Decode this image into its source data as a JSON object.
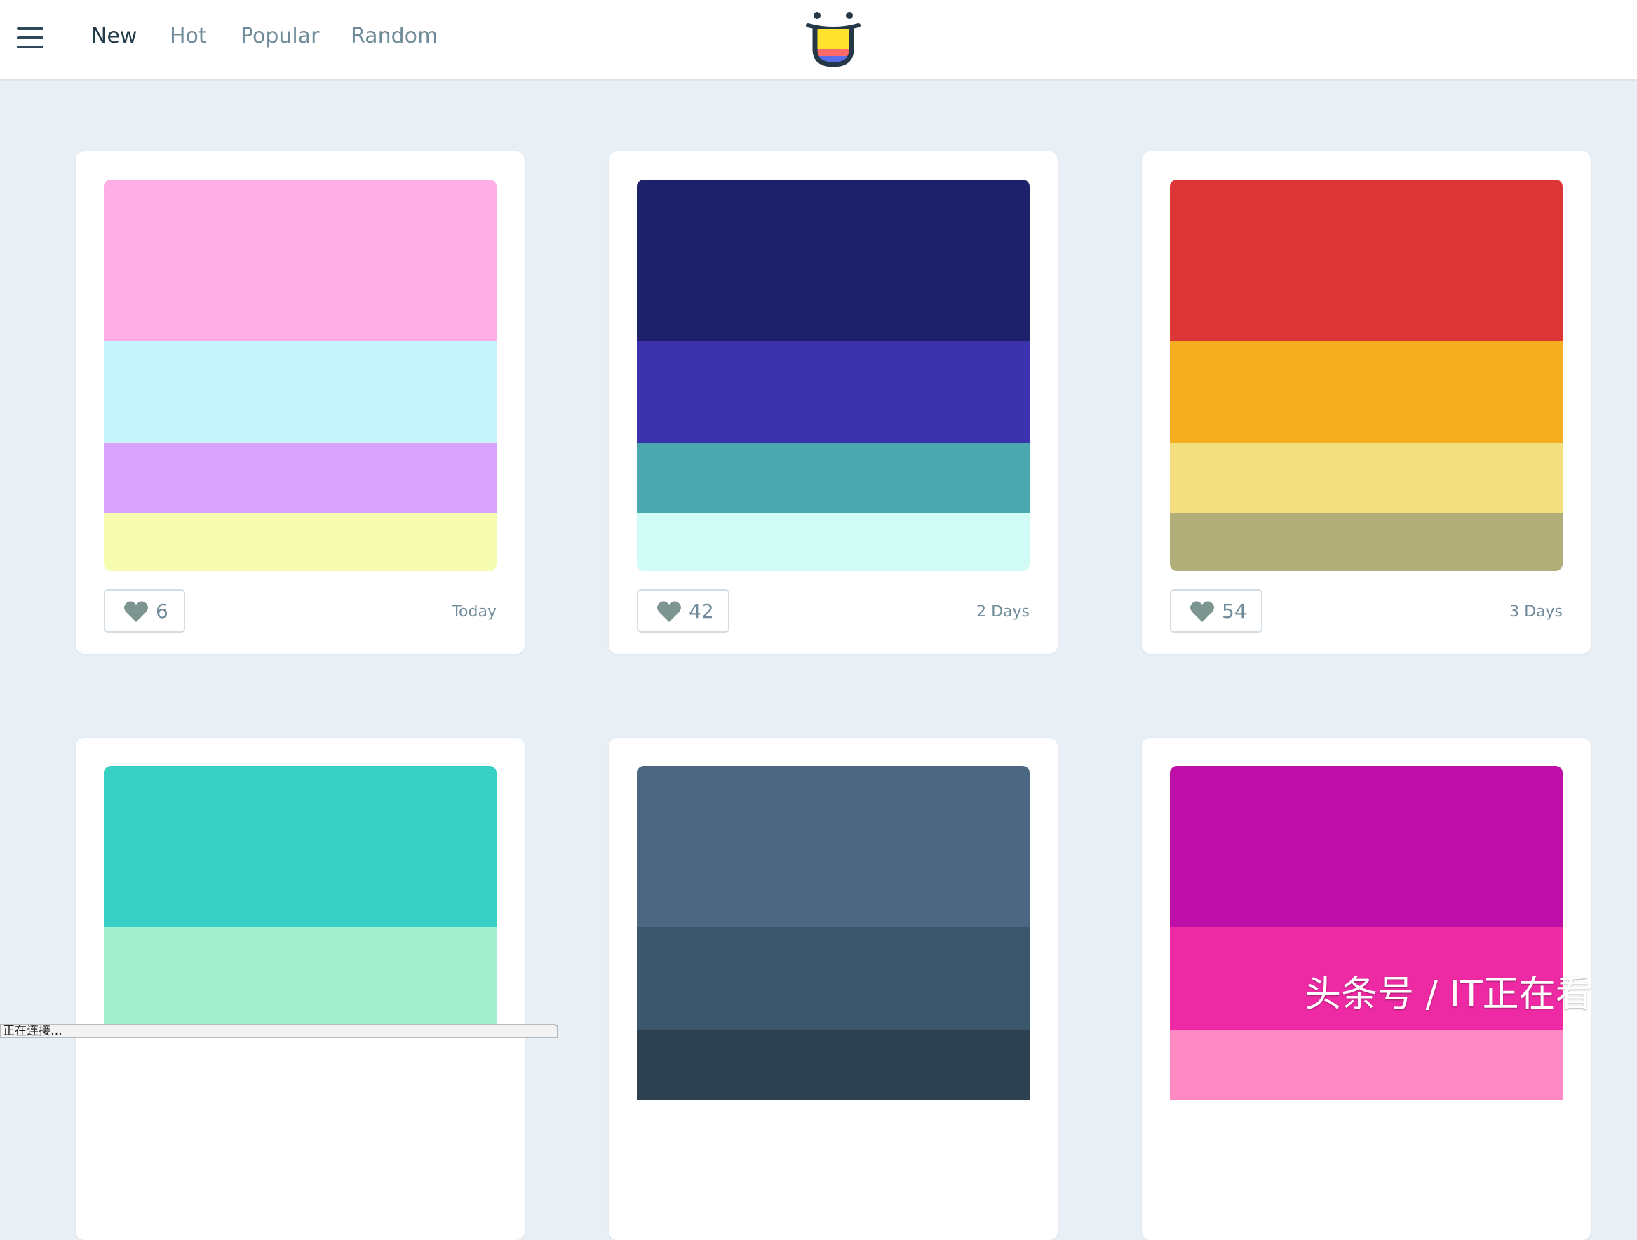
{
  "nav": {
    "items": [
      {
        "label": "New",
        "active": true
      },
      {
        "label": "Hot",
        "active": false
      },
      {
        "label": "Popular",
        "active": false
      },
      {
        "label": "Random",
        "active": false
      }
    ]
  },
  "palettes": [
    {
      "colors": [
        "#ffafe5",
        "#c7f3fc",
        "#d9a3fb",
        "#f5fcb0"
      ],
      "likes": "6",
      "date": "Today"
    },
    {
      "colors": [
        "#1d216b",
        "#3d32ad",
        "#4aa8ae",
        "#d1fcf5"
      ],
      "likes": "42",
      "date": "2 Days"
    },
    {
      "colors": [
        "#dc3636",
        "#f5ae1f",
        "#f3df80",
        "#b1ae7a"
      ],
      "likes": "54",
      "date": "3 Days"
    },
    {
      "colors": [
        "#36d1c4",
        "#a3efce",
        "#ffffff",
        "#ffffff"
      ],
      "likes": "",
      "date": ""
    },
    {
      "colors": [
        "#4b6782",
        "#3a576b",
        "#2d4150",
        "#ffffff"
      ],
      "likes": "",
      "date": ""
    },
    {
      "colors": [
        "#be10a9",
        "#ed2aa3",
        "#ff89c2",
        "#ffffff"
      ],
      "likes": "",
      "date": ""
    }
  ],
  "status_bar": {
    "text": "正在连接…"
  },
  "watermark": {
    "text": "头条号 / IT正在看"
  },
  "theme": {
    "nav_active": "#233a48",
    "nav_inactive": "#6f8b99",
    "page_background": "#e8eff5",
    "heart": "#7d9591"
  }
}
